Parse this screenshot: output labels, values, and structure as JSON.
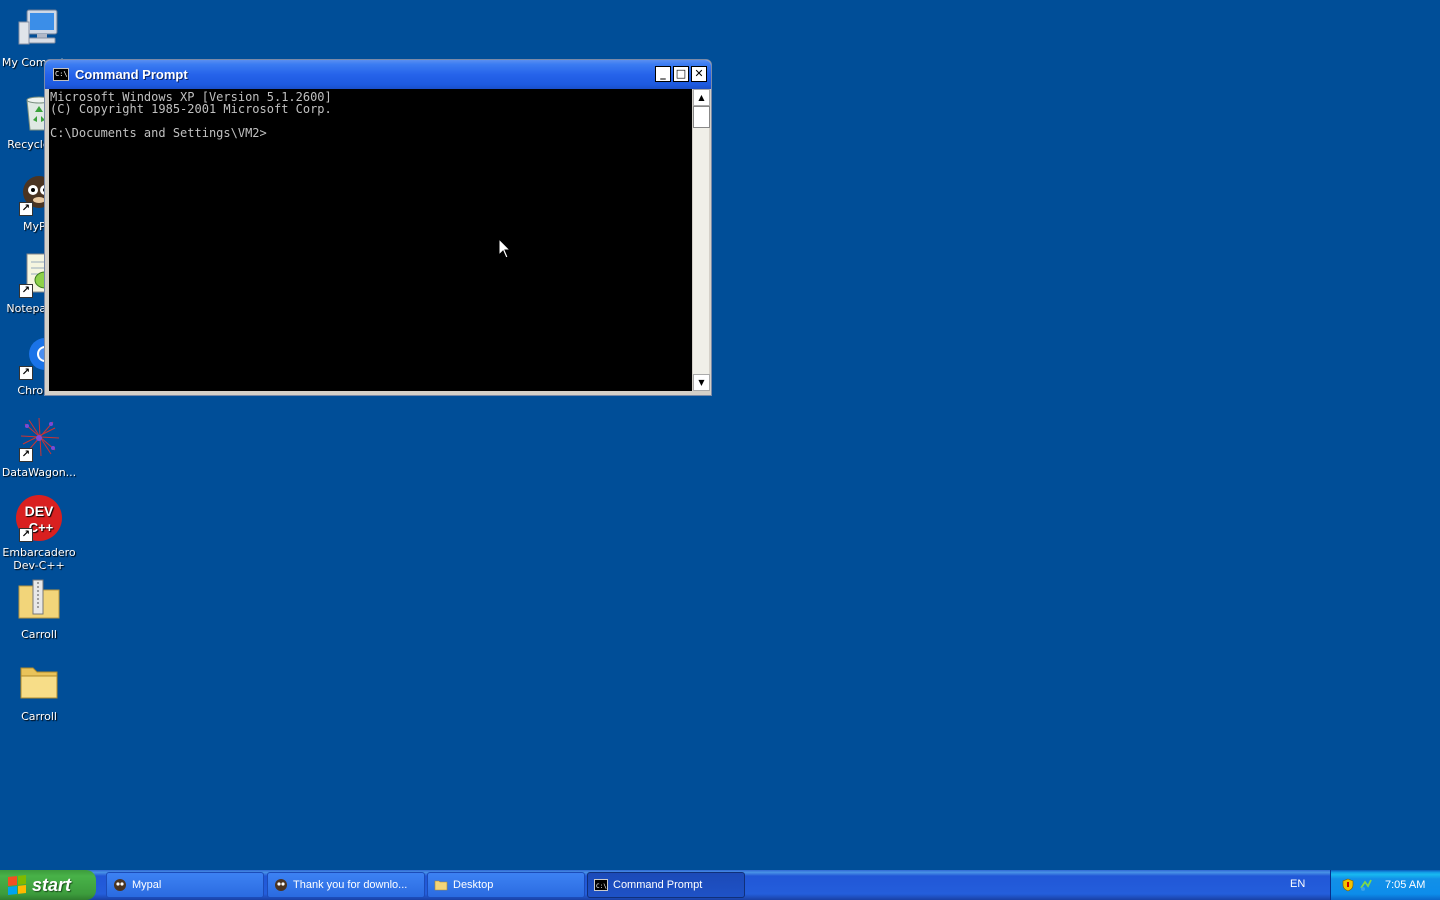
{
  "desktop": {
    "icons": [
      {
        "label": "My Computer",
        "icon": "my-computer-icon"
      },
      {
        "label": "Recycle Bin",
        "icon": "recycle-bin-icon"
      },
      {
        "label": "MyPal",
        "icon": "mypal-icon"
      },
      {
        "label": "Notepad++",
        "icon": "notepad-plus-plus-icon"
      },
      {
        "label": "Chrome",
        "icon": "chrome-icon"
      },
      {
        "label": "DataWagon...",
        "icon": "datawagon-icon"
      },
      {
        "label": "Embarcadero Dev-C++",
        "icon": "dev-cpp-icon"
      },
      {
        "label": "Carroll",
        "icon": "zip-folder-icon"
      },
      {
        "label": "Carroll",
        "icon": "folder-icon"
      }
    ],
    "background_color": "#004e98"
  },
  "window": {
    "title": "Command Prompt",
    "icon_text": "C:\\",
    "minimize": "_",
    "maximize": "□",
    "close": "✕",
    "console_lines": [
      "Microsoft Windows XP [Version 5.1.2600]",
      "(C) Copyright 1985-2001 Microsoft Corp.",
      "",
      "C:\\Documents and Settings\\VM2>"
    ],
    "scroll_up": "▲",
    "scroll_down": "▼"
  },
  "taskbar": {
    "start_label": "start",
    "tasks": [
      {
        "label": "Mypal",
        "icon": "mypal-icon",
        "active": false
      },
      {
        "label": "Thank you for downlo...",
        "icon": "mypal-icon",
        "active": false
      },
      {
        "label": "Desktop",
        "icon": "folder-icon",
        "active": false
      },
      {
        "label": "Command Prompt",
        "icon": "cmd-icon",
        "active": true
      }
    ],
    "language": "EN",
    "clock": "7:05 AM"
  }
}
